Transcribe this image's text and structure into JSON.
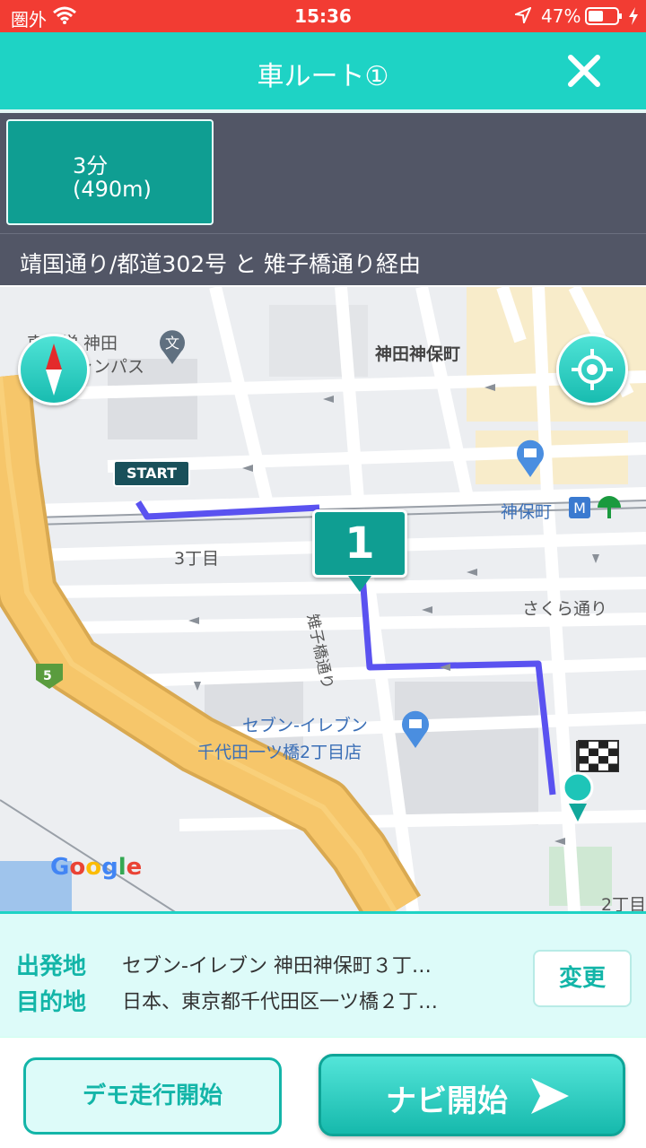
{
  "status_bar": {
    "carrier": "圏外",
    "time": "15:36",
    "battery": "47%"
  },
  "header": {
    "title": "車ルート①"
  },
  "route": {
    "time": "3分",
    "distance": "(490m)",
    "via": "靖国通り/都道302号 と 雉子橋通り経由"
  },
  "map": {
    "start_label": "START",
    "waypoint_number": "1",
    "labels": {
      "university": "東大学 神田",
      "campus": "キャンパス",
      "jinbocho": "神田神保町",
      "jinbocho_station": "神保町",
      "chome3": "3丁目",
      "sakura": "さくら通り",
      "route5": "5",
      "kijibashi": "雉子橋通り",
      "store_line1": "セブン-イレブン",
      "store_line2": "千代田一ツ橋2丁目店",
      "chome2": "2丁目",
      "google": "Google"
    },
    "colors": {
      "route": "#5a52f0",
      "highway": "#f6c66a",
      "accent": "#1ed3c5"
    }
  },
  "locations": {
    "origin_label": "出発地",
    "origin_value": "セブン-イレブン 神田神保町３丁…",
    "destination_label": "目的地",
    "destination_value": "日本、東京都千代田区一ツ橋２丁…",
    "change_button": "変更"
  },
  "buttons": {
    "demo": "デモ走行開始",
    "navi": "ナビ開始"
  },
  "icons": [
    "wifi-icon",
    "location-arrow-icon",
    "battery-icon",
    "charging-icon",
    "close-icon",
    "compass-icon",
    "current-location-icon",
    "school-icon",
    "store-icon",
    "metro-icon",
    "goal-flag-icon",
    "play-arrow-icon"
  ]
}
